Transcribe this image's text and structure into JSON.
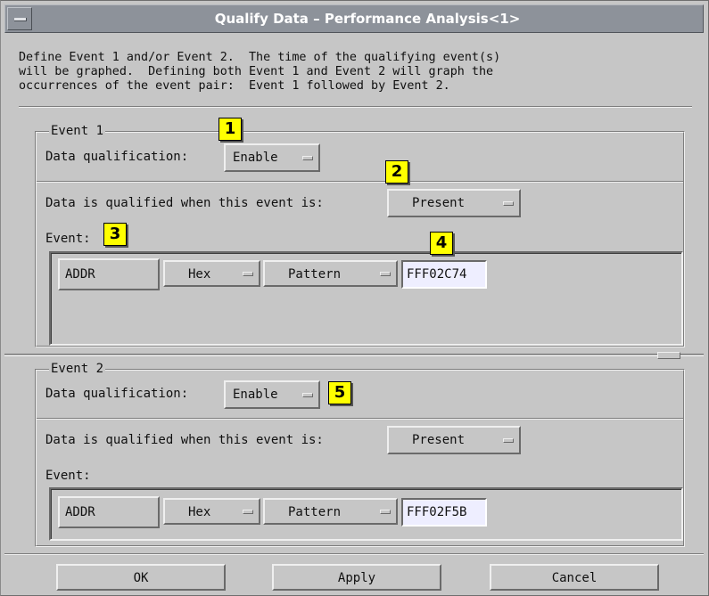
{
  "window": {
    "title": "Qualify Data – Performance Analysis<1>"
  },
  "description": "Define Event 1 and/or Event 2.  The time of the qualifying event(s)\nwill be graphed.  Defining both Event 1 and Event 2 will graph the\noccurrences of the event pair:  Event 1 followed by Event 2.",
  "event1": {
    "legend": "Event 1",
    "qualification_label": "Data qualification:",
    "qualification_value": "Enable",
    "condition_label": "Data is qualified when this event is:",
    "condition_value": "Present",
    "event_label": "Event:",
    "row": {
      "label": "ADDR",
      "base": "Hex",
      "mode": "Pattern",
      "value": "FFF02C74"
    }
  },
  "event2": {
    "legend": "Event 2",
    "qualification_label": "Data qualification:",
    "qualification_value": "Enable",
    "condition_label": "Data is qualified when this event is:",
    "condition_value": "Present",
    "event_label": "Event:",
    "row": {
      "label": "ADDR",
      "base": "Hex",
      "mode": "Pattern",
      "value": "FFF02F5B"
    }
  },
  "callouts": [
    "1",
    "2",
    "3",
    "4",
    "5"
  ],
  "footer": {
    "ok": "OK",
    "apply": "Apply",
    "cancel": "Cancel"
  },
  "colors": {
    "background": "#c6c6c6",
    "titlebar": "#8d929a",
    "callout": "#ffff00",
    "input": "#eeeeff"
  },
  "icons": {
    "system_menu": "window-menu-icon",
    "option_indicator": "option-menu-indicator-icon"
  }
}
